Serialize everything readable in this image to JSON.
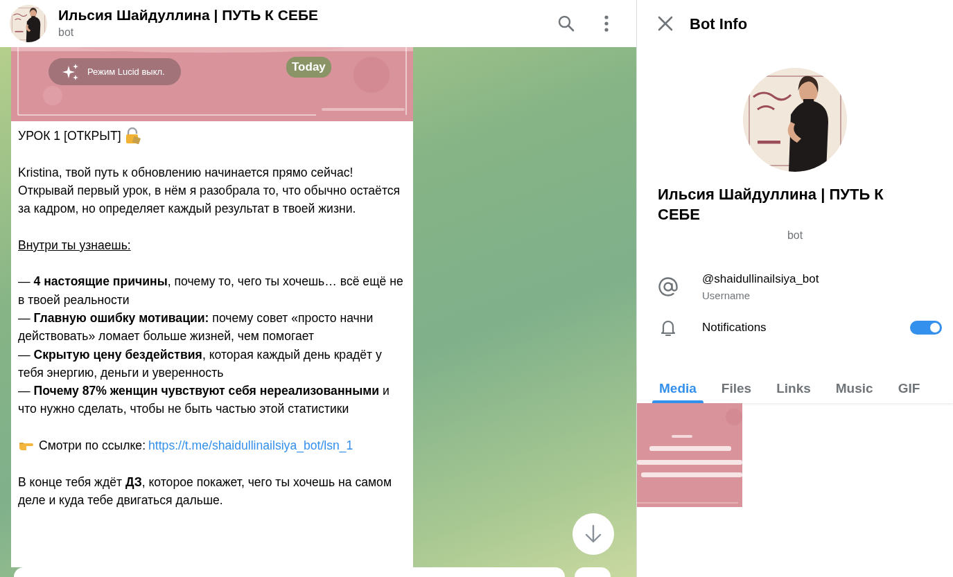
{
  "chat": {
    "title": "Ильсия Шайдуллина | ПУТЬ К СЕБЕ",
    "subtitle": "bot"
  },
  "message": {
    "lucid_button": "Режим Lucid выкл.",
    "date_badge": "Today",
    "paragraphs": [
      [
        {
          "kind": "heading",
          "text": "УРОК 1 [ОТКРЫТ]"
        }
      ],
      [
        {
          "kind": "text",
          "text": "Kristina, твой путь к обновлению начинается прямо сейчас! Открывай первый урок, в нём я разобрала то, что обычно остаётся за кадром, но определяет каждый результат в твоей жизни."
        }
      ],
      [
        {
          "kind": "underline",
          "text": "Внутри ты узнаешь:"
        }
      ],
      [
        {
          "kind": "text",
          "text": "— **4 настоящие причины**, почему то, чего ты хочешь… всё ещё не в твоей реальности"
        },
        {
          "kind": "text",
          "text": "— **Главную ошибку мотивации:** почему совет «просто начни действовать» ломает больше жизней, чем помогает"
        },
        {
          "kind": "text",
          "text": "— **Скрытую цену бездействия**, которая каждый день крадёт у тебя энергию, деньги и уверенность"
        },
        {
          "kind": "text",
          "text": "— **Почему 87% женщин чувствуют себя нереализованными** и что нужно сделать, чтобы не быть частью этой статистики"
        }
      ],
      [
        {
          "kind": "link",
          "text": "Смотри по ссылке:",
          "url": "https://t.me/shaidullinailsiya_bot/lsn_1"
        }
      ],
      [
        {
          "kind": "text",
          "text": "В конце тебя ждёт **ДЗ**, которое покажет, чего ты хочешь на самом деле и куда тебе двигаться дальше."
        }
      ]
    ]
  },
  "info_panel": {
    "title": "Bot Info",
    "name": "Ильсия Шайдуллина | ПУТЬ К СЕБЕ",
    "subtitle": "bot",
    "username": "@shaidullinailsiya_bot",
    "username_label": "Username",
    "notifications": {
      "label": "Notifications",
      "on": true
    },
    "tabs": [
      {
        "label": "Media",
        "selected": true
      },
      {
        "label": "Files",
        "selected": false
      },
      {
        "label": "Links",
        "selected": false
      },
      {
        "label": "Music",
        "selected": false
      },
      {
        "label": "GIF",
        "selected": false
      }
    ]
  }
}
